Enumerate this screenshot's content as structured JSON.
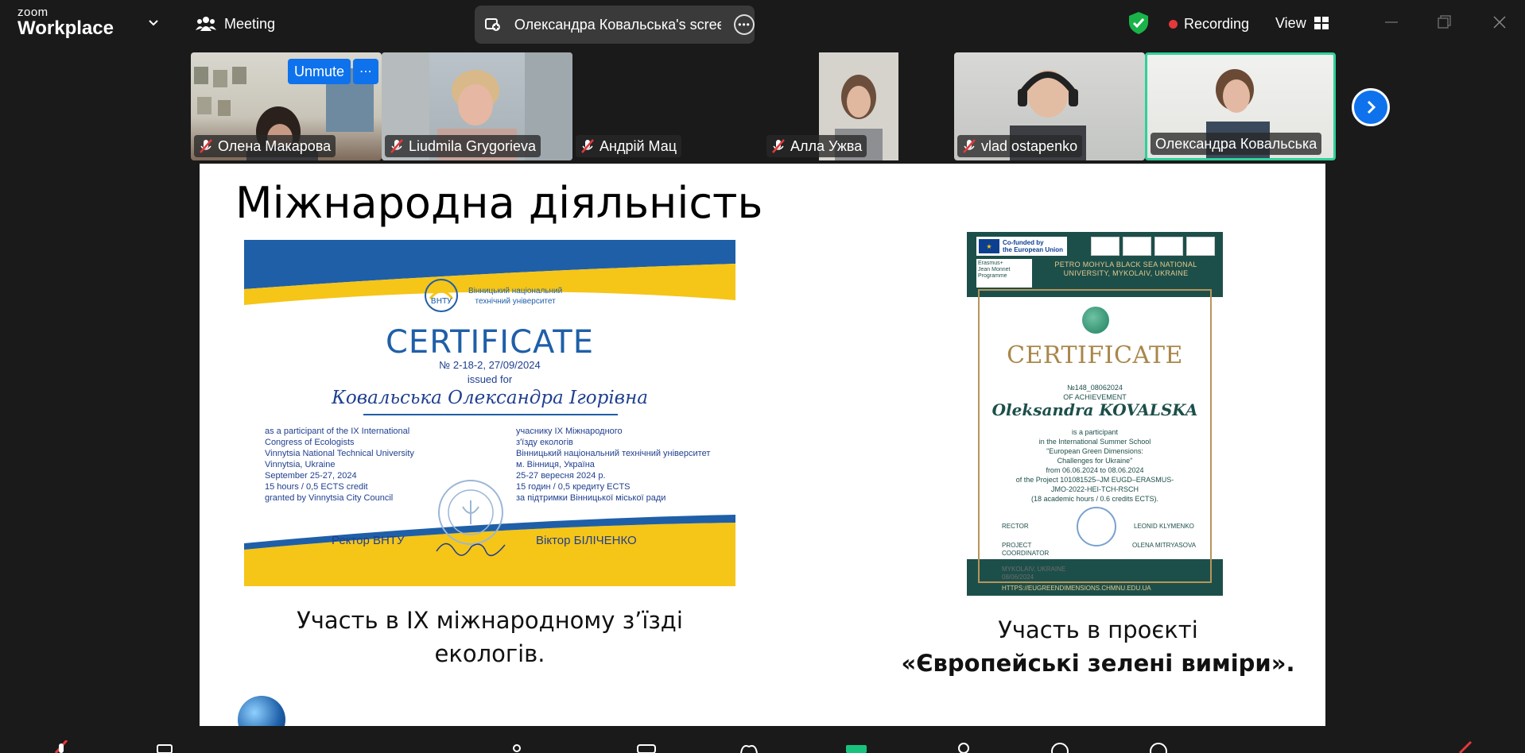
{
  "app": {
    "brand_small": "zoom",
    "brand_large": "Workplace",
    "meeting_label": "Meeting",
    "share_title": "Олександра Ковальська's screen"
  },
  "status": {
    "recording_label": "Recording",
    "view_label": "View"
  },
  "gallery": {
    "unmute_label": "Unmute",
    "participants": [
      {
        "name": "Олена Макарова",
        "muted": true
      },
      {
        "name": "Liudmila Grygorieva",
        "muted": true
      },
      {
        "name": "Андрій Мац",
        "muted": true
      },
      {
        "name": "Алла Ужва",
        "muted": true
      },
      {
        "name": "vlad ostapenko",
        "muted": true
      },
      {
        "name": "Олександра Ковальська",
        "muted": false,
        "active_speaker": true
      }
    ]
  },
  "slide": {
    "title": "Міжнародна діяльність",
    "cert1": {
      "university": [
        "Вінницький національний",
        "технічний університет"
      ],
      "logo_text": "ВНТУ",
      "heading": "CERTIFICATE",
      "number": "№ 2-18-2, 27/09/2024",
      "issued_for": "issued for",
      "recipient": "Ковальська Олександра Ігорівна",
      "left_col": [
        "as a participant of the IX International",
        "Congress of Ecologists",
        "Vinnytsia National Technical University",
        "Vinnytsia, Ukraine",
        "September 25-27, 2024",
        "15 hours / 0,5 ECTS credit",
        "granted by Vinnytsia City Council"
      ],
      "right_col": [
        "учаснику IX Міжнародного",
        "з'їзду екологів",
        "Вінницький національний технічний університет",
        "м. Вінниця, Україна",
        "25-27 вересня 2024 р.",
        "15 годин / 0,5 кредиту ECTS",
        "за підтримки Вінницької міської ради"
      ],
      "rector_label": "Ректор ВНТУ",
      "rector_name": "Віктор БІЛІЧЕНКО"
    },
    "caption1": [
      "Участь в ІХ міжнародному з’їзді",
      "екологів."
    ],
    "cert2": {
      "eu_text": [
        "Co-funded by",
        "the European Union"
      ],
      "erasmus_text": [
        "Erasmus+",
        "Jean Monnet",
        "Programme"
      ],
      "university": [
        "PETRO MOHYLA BLACK SEA NATIONAL",
        "UNIVERSITY, MYKOLAIV, UKRAINE"
      ],
      "heading": "CERTIFICATE",
      "number": "№148_08062024",
      "of_achievement": "OF ACHIEVEMENT",
      "recipient": "Oleksandra KOVALSKA",
      "body": [
        "is a participant",
        "in the International Summer School",
        "\"European Green Dimensions:",
        "Challenges for Ukraine\"",
        "from 06.06.2024 to 08.06.2024",
        "of the Project 101081525–JM EUGD–ERASMUS-",
        "JMO-2022-HEI-TCH-RSCH",
        "(18 academic hours / 0.6 credits ECTS)."
      ],
      "rector_label": "RECTOR",
      "rector_name": "LEONID KLYMENKO",
      "coord_label": [
        "PROJECT",
        "COORDINATOR"
      ],
      "coord_name": "OLENA MITRYASOVA",
      "place_date": [
        "MYKOLAIV, UKRAINE",
        "08/06/2024"
      ],
      "url": "HTTPS://EUGREENDIMENSIONS.CHMNU.EDU.UA"
    },
    "caption2_line1": "Участь в проєкті",
    "caption2_line2": "«Європейські зелені виміри»."
  },
  "colors": {
    "zoom_blue": "#0e72ed",
    "active_border": "#2fd19a",
    "recording_red": "#e5383b",
    "shield_green": "#19b34a"
  }
}
